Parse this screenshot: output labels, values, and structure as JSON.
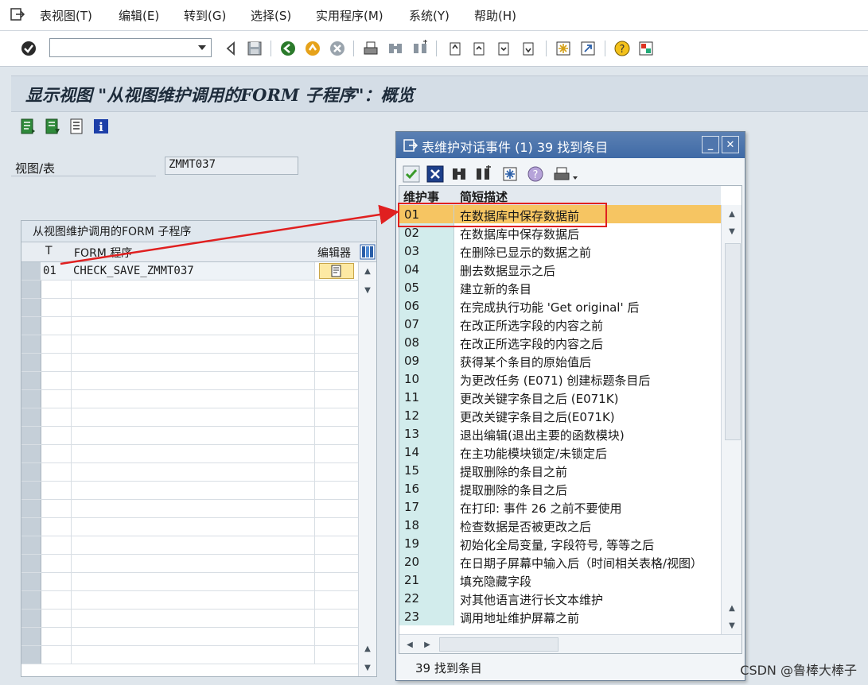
{
  "menu": [
    "表视图(T)",
    "编辑(E)",
    "转到(G)",
    "选择(S)",
    "实用程序(M)",
    "系统(Y)",
    "帮助(H)"
  ],
  "command_field": {
    "value": "",
    "placeholder": ""
  },
  "screen_title": "显示视图 \"从视图维护调用的FORM 子程序\"：概览",
  "view_table": {
    "label": "视图/表",
    "value": "ZMMT037"
  },
  "left_table": {
    "title": "从视图维护调用的FORM 子程序",
    "headers": {
      "t": "T",
      "form": "FORM 程序",
      "editor": "编辑器"
    },
    "rows": [
      {
        "t": "01",
        "form": "CHECK_SAVE_ZMMT037"
      }
    ]
  },
  "dialog": {
    "title": "表维护对话事件 (1)   39 找到条目",
    "headers": {
      "event": "维护事",
      "desc": "简短描述"
    },
    "rows": [
      {
        "code": "01",
        "desc": "在数据库中保存数据前"
      },
      {
        "code": "02",
        "desc": "在数据库中保存数据后"
      },
      {
        "code": "03",
        "desc": "在删除已显示的数据之前"
      },
      {
        "code": "04",
        "desc": "删去数据显示之后"
      },
      {
        "code": "05",
        "desc": "建立新的条目"
      },
      {
        "code": "06",
        "desc": "在完成执行功能 'Get original' 后"
      },
      {
        "code": "07",
        "desc": "在改正所选字段的内容之前"
      },
      {
        "code": "08",
        "desc": "在改正所选字段的内容之后"
      },
      {
        "code": "09",
        "desc": "获得某个条目的原始值后"
      },
      {
        "code": "10",
        "desc": "为更改任务 (E071) 创建标题条目后"
      },
      {
        "code": "11",
        "desc": "更改关键字条目之后 (E071K)"
      },
      {
        "code": "12",
        "desc": "更改关键字条目之后(E071K)"
      },
      {
        "code": "13",
        "desc": "退出编辑(退出主要的函数模块)"
      },
      {
        "code": "14",
        "desc": "在主功能模块锁定/未锁定后"
      },
      {
        "code": "15",
        "desc": "提取删除的条目之前"
      },
      {
        "code": "16",
        "desc": "提取删除的条目之后"
      },
      {
        "code": "17",
        "desc": "在打印: 事件 26 之前不要使用"
      },
      {
        "code": "18",
        "desc": "检查数据是否被更改之后"
      },
      {
        "code": "19",
        "desc": "初始化全局变量, 字段符号, 等等之后"
      },
      {
        "code": "20",
        "desc": "在日期子屏幕中输入后（时间相关表格/视图）"
      },
      {
        "code": "21",
        "desc": "填充隐藏字段"
      },
      {
        "code": "22",
        "desc": "对其他语言进行长文本维护"
      },
      {
        "code": "23",
        "desc": "调用地址维护屏幕之前"
      }
    ],
    "status": "39 找到条目"
  },
  "watermark": "CSDN @鲁棒大棒子",
  "colors": {
    "highlight": "#f6c562",
    "key_col": "#d2ecec",
    "annotation": "#e02020",
    "title_blue": "#3f6aa6"
  }
}
